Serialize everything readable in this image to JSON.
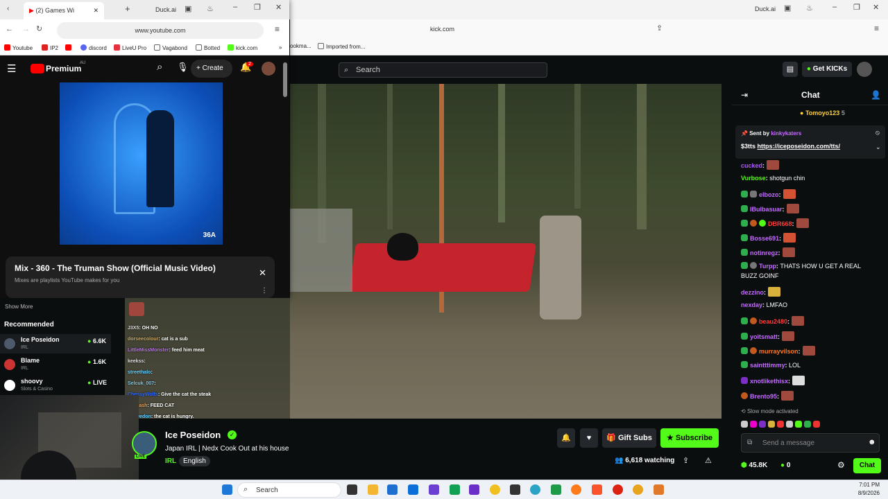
{
  "kick_window": {
    "tab_title": "Duck.ai",
    "address": "kick.com",
    "bookmarks": [
      "ookma...",
      "Imported from..."
    ]
  },
  "youtube_window": {
    "tab_title": "(2) Games Wi",
    "tab_right": "Duck.ai",
    "address": "www.youtube.com",
    "bookmarks": [
      "Youtube",
      "IP2",
      "discord",
      "LiveU Pro",
      "Vagabond",
      "Botted",
      "kick.com"
    ],
    "logo": "Premium",
    "region": "AU",
    "create_label": "Create",
    "notification_count": "2",
    "mix_title": "Mix - 360 - The Truman Show (Official Music Video)",
    "mix_subtitle": "Mixes are playlists YouTube makes for you",
    "art_mark": "36A"
  },
  "kick": {
    "search_placeholder": "Search",
    "get_kicks": "Get KICKs",
    "sidebar": {
      "show_more": "Show More",
      "recommended": "Recommended",
      "channels": [
        {
          "name": "Ice Poseidon",
          "category": "IRL",
          "viewers": "6.6K"
        },
        {
          "name": "Blame",
          "category": "IRL",
          "viewers": "1.6K"
        },
        {
          "name": "shoovy",
          "category": "Slots & Casino",
          "viewers": "LIVE"
        }
      ]
    },
    "overlay_chat": [
      {
        "user": "J3X5",
        "text": "OH NO",
        "color": "#ffffff"
      },
      {
        "user": "dorseecolour",
        "text": "cat is a sub",
        "color": "#c7a86a"
      },
      {
        "user": "LittleMissMonster",
        "text": "feed him meat",
        "color": "#c46cff"
      },
      {
        "user": "keekss",
        "text": "",
        "color": "#e0e0e0"
      },
      {
        "user": "streethalo",
        "text": "",
        "color": "#65d1ff"
      },
      {
        "user": "Selcuk_007",
        "text": "",
        "color": "#65d1ff"
      },
      {
        "user": "ChessyWolfs",
        "text": "Give the cat the steak",
        "color": "#2f6bff"
      },
      {
        "user": "andkash",
        "text": "FEED CAT",
        "color": "#ff9b3d"
      },
      {
        "user": "a_swedon",
        "text": "the cat is hungry.",
        "color": "#65d1ff"
      }
    ],
    "streamer": {
      "name": "Ice Poseidon",
      "title": "Japan IRL | Nedx Cook Out at his house",
      "category": "IRL",
      "language": "English",
      "watching": "6,618 watching",
      "gift_subs": "Gift Subs",
      "subscribe": "Subscribe",
      "live_badge": "LIVE"
    },
    "chat": {
      "header": "Chat",
      "top_gifter": "Tomoyo123",
      "top_gifter_count": "5",
      "pinned_sender_label": "Sent by",
      "pinned_sender": "kinkykaters",
      "pinned_text_prefix": "$3tts",
      "pinned_link": "https://iceposeidon.com/tts/",
      "messages": [
        {
          "user": "cucked",
          "text": "",
          "color": "#b05bff"
        },
        {
          "user": "Vurbose",
          "text": "shotgun chin",
          "color": "#53fc18"
        },
        {
          "user": "elbozo",
          "text": "",
          "color": "#c46cff"
        },
        {
          "user": "lBulbasuar",
          "text": "",
          "color": "#c46cff"
        },
        {
          "user": "DBR668",
          "text": "",
          "color": "#ff3b3b"
        },
        {
          "user": "Bosse691",
          "text": "",
          "color": "#c46cff"
        },
        {
          "user": "notinregz",
          "text": "",
          "color": "#c46cff"
        },
        {
          "user": "Turpp",
          "text": "THATS HOW U GET A REAL",
          "color": "#c46cff"
        },
        {
          "user": "",
          "text": "BUZZ GOINF",
          "color": "#ffffff"
        },
        {
          "user": "dezzino",
          "text": "",
          "color": "#c46cff"
        },
        {
          "user": "nexday",
          "text": "LMFAO",
          "color": "#c46cff"
        },
        {
          "user": "beau2480",
          "text": "",
          "color": "#ff3b3b"
        },
        {
          "user": "yoitsmatt",
          "text": "",
          "color": "#c46cff"
        },
        {
          "user": "murrayvilson",
          "text": "",
          "color": "#ff7a2a"
        },
        {
          "user": "saintttimmy",
          "text": "LOL",
          "color": "#c46cff"
        },
        {
          "user": "xnotlikethisx",
          "text": "",
          "color": "#c46cff"
        },
        {
          "user": "Brento95",
          "text": "",
          "color": "#c46cff"
        }
      ],
      "slow_mode": "Slow mode activated",
      "input_placeholder": "Send a message",
      "followers": "45.8K",
      "kicks": "0",
      "send_label": "Chat"
    }
  },
  "taskbar": {
    "search": "Search",
    "time": "7:01 PM",
    "date": "8/9/2026"
  },
  "colors": {
    "kick_green": "#53fc18",
    "yt_red": "#ff0000",
    "chat_bg": "#0b0e0f"
  }
}
